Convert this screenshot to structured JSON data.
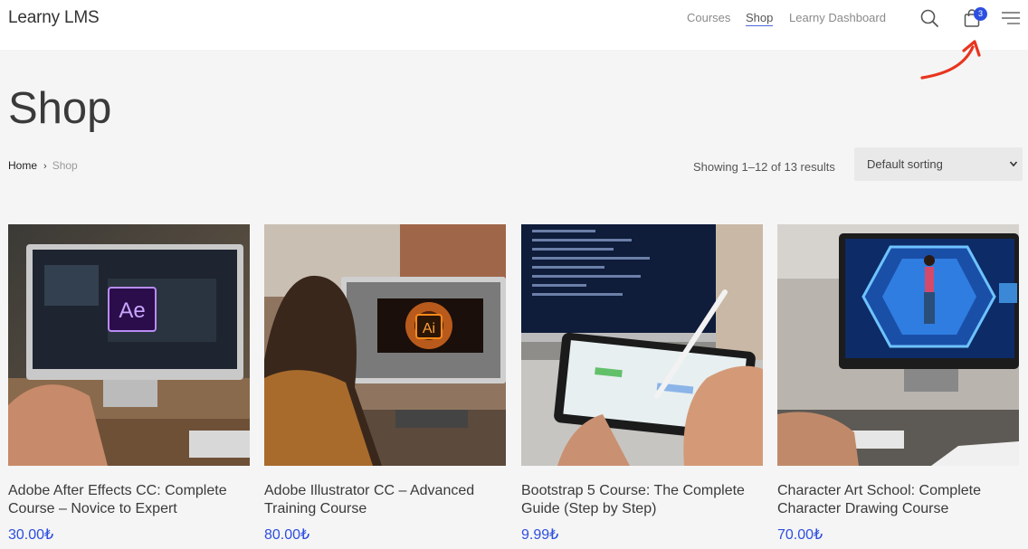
{
  "header": {
    "logo": "Learny LMS",
    "nav": [
      "Courses",
      "Shop",
      "Learny Dashboard"
    ],
    "cart_count": "3",
    "icons": [
      "search-icon",
      "cart-icon",
      "menu-icon"
    ]
  },
  "page": {
    "title": "Shop"
  },
  "breadcrumb": {
    "home": "Home",
    "current": "Shop"
  },
  "toolbar": {
    "results": "Showing 1–12 of 13 results",
    "sort_selected": "Default sorting"
  },
  "products": [
    {
      "name": "Adobe After Effects CC: Complete Course – Novice to Expert",
      "price": "30.00₺",
      "badge": "Ae"
    },
    {
      "name": "Adobe Illustrator CC – Advanced Training Course",
      "price": "80.00₺",
      "badge": "Ai"
    },
    {
      "name": "Bootstrap 5 Course: The Complete Guide (Step by Step)",
      "price": "9.99₺"
    },
    {
      "name": "Character Art School: Complete Character Drawing Course",
      "price": "70.00₺"
    }
  ],
  "colors": {
    "accent": "#2d4fe0",
    "annotation": "#e8351f",
    "background": "#f5f5f5"
  }
}
